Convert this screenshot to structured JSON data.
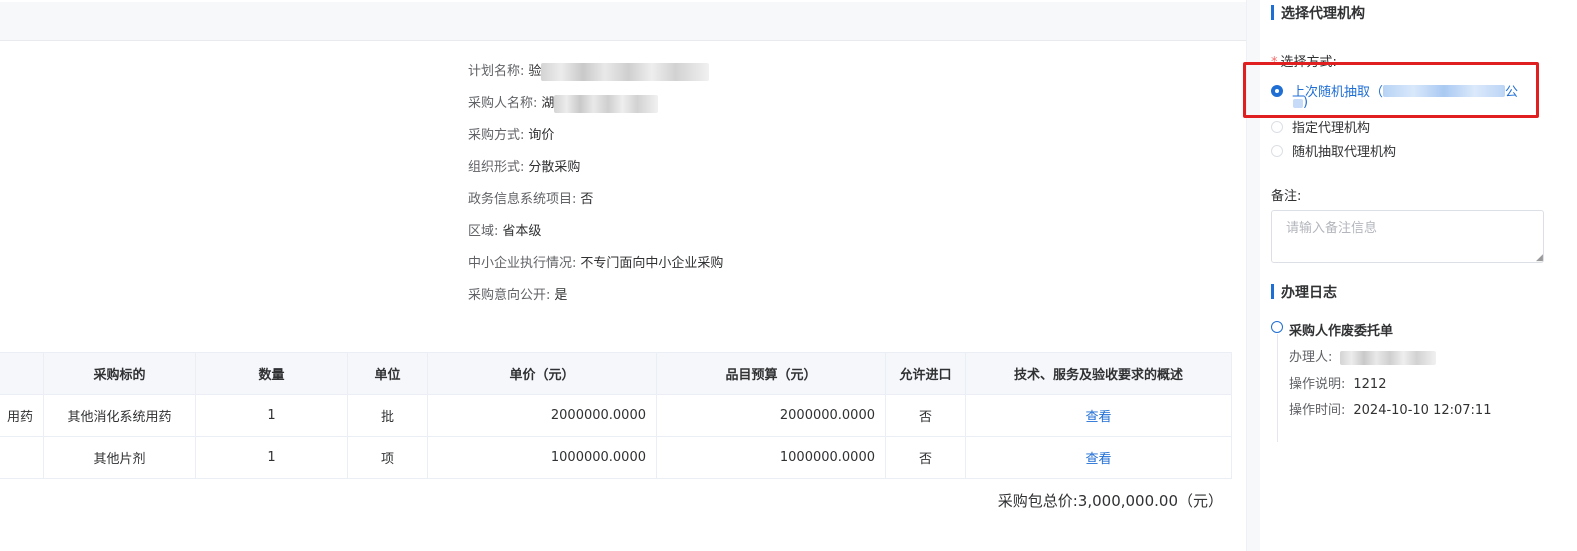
{
  "info": {
    "plan_name_label": "计划名称:",
    "plan_name_value": "验",
    "purchaser_label": "采购人名称:",
    "purchaser_value": "湖",
    "method_label": "采购方式:",
    "method_value": "询价",
    "org_label": "组织形式:",
    "org_value": "分散采购",
    "egov_label": "政务信息系统项目:",
    "egov_value": "否",
    "region_label": "区域:",
    "region_value": "省本级",
    "sme_label": "中小企业执行情况:",
    "sme_value": "不专门面向中小企业采购",
    "intent_label": "采购意向公开:",
    "intent_value": "是"
  },
  "table": {
    "headers": [
      "采购标的",
      "数量",
      "单位",
      "单价（元）",
      "品目预算（元）",
      "允许进口",
      "技术、服务及验收要求的概述"
    ],
    "rows": [
      {
        "cut": "用药",
        "target": "其他消化系统用药",
        "qty": "1",
        "unit": "批",
        "price": "2000000.0000",
        "budget": "2000000.0000",
        "import": "否",
        "action": "查看"
      },
      {
        "cut": "",
        "target": "其他片剂",
        "qty": "1",
        "unit": "项",
        "price": "1000000.0000",
        "budget": "1000000.0000",
        "import": "否",
        "action": "查看"
      }
    ]
  },
  "total": {
    "label": "采购包总价:",
    "value": "3,000,000.00（元）"
  },
  "agency": {
    "title": "选择代理机构",
    "method_label": "选择方式:",
    "required_mark": "*",
    "options": [
      {
        "label": "上次随机抽取（",
        "suffix": "公",
        "tail": ")",
        "checked": true
      },
      {
        "label": "指定代理机构",
        "checked": false
      },
      {
        "label": "随机抽取代理机构",
        "checked": false
      }
    ],
    "note_label": "备注:",
    "note_placeholder": "请输入备注信息"
  },
  "log": {
    "title": "办理日志",
    "entry_title": "采购人作废委托单",
    "handler_label": "办理人:",
    "desc_label": "操作说明:",
    "desc_value": "1212",
    "time_label": "操作时间:",
    "time_value": "2024-10-10 12:07:11"
  },
  "colors": {
    "accent": "#1f6ed4",
    "highlight": "#e02020",
    "required": "#f56c6c"
  }
}
